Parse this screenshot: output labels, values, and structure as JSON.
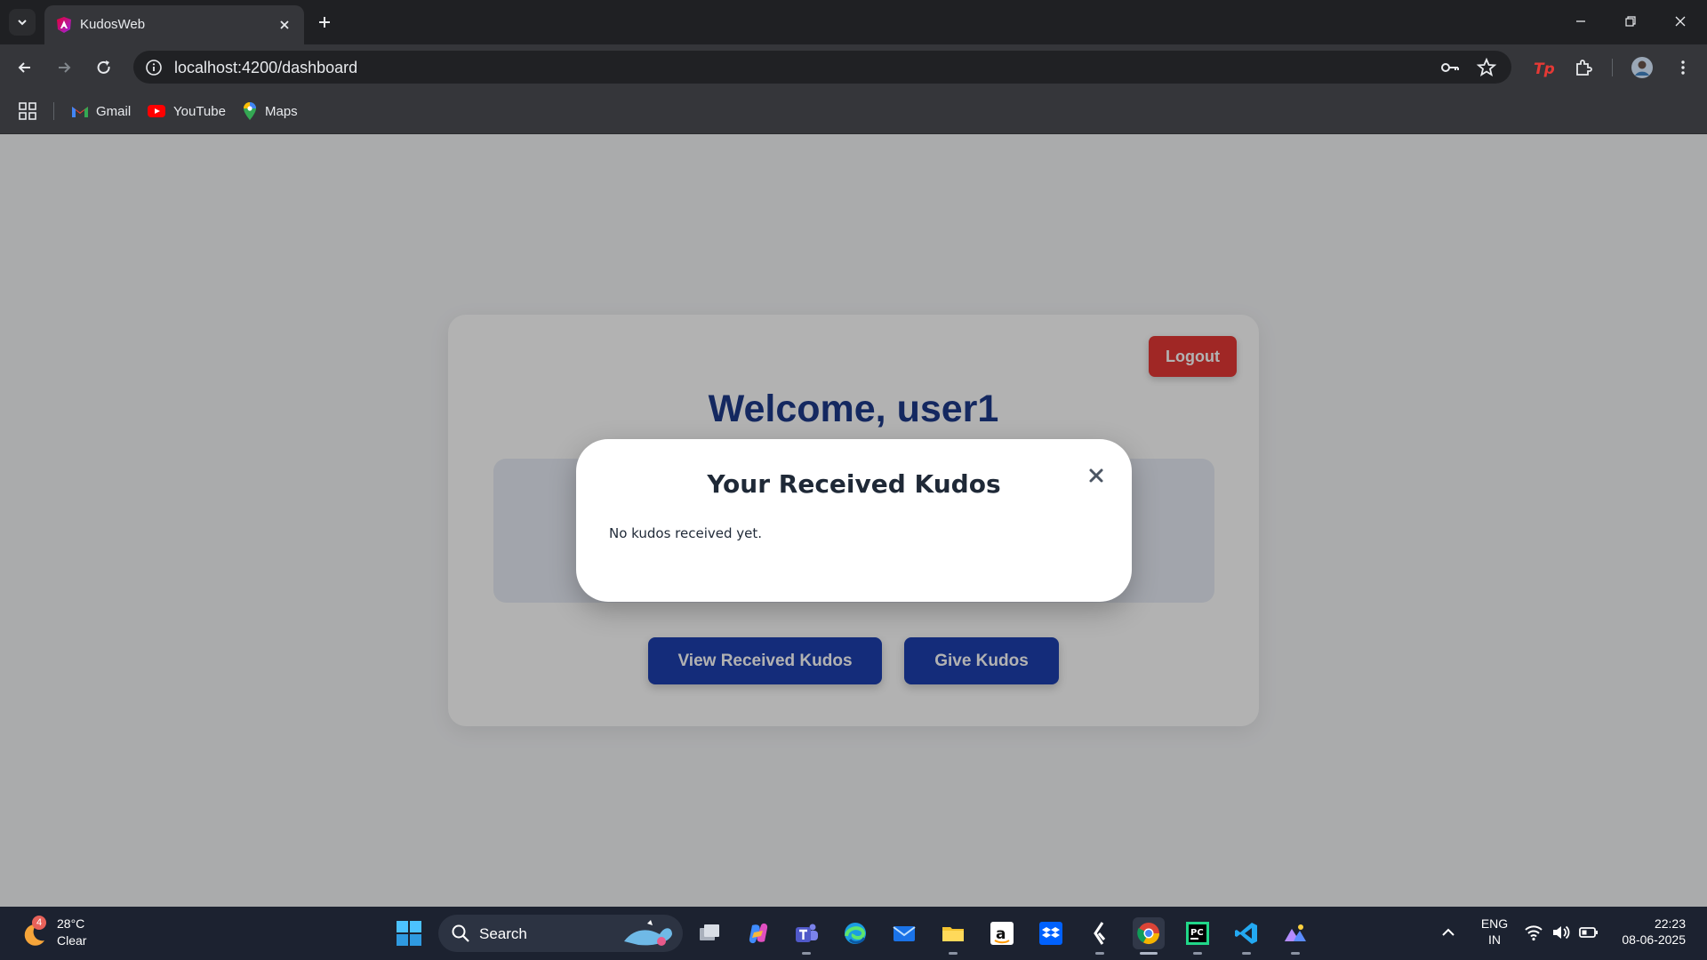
{
  "browser": {
    "tab_title": "KudosWeb",
    "url": "localhost:4200/dashboard",
    "bookmarks": [
      {
        "label": "Gmail",
        "icon": "gmail-icon"
      },
      {
        "label": "YouTube",
        "icon": "youtube-icon"
      },
      {
        "label": "Maps",
        "icon": "maps-icon"
      }
    ]
  },
  "dashboard": {
    "logout_label": "Logout",
    "welcome": "Welcome, user1",
    "view_button": "View Received Kudos",
    "give_button": "Give Kudos"
  },
  "modal": {
    "title": "Your Received Kudos",
    "empty_text": "No kudos received yet.",
    "close_icon": "close-icon"
  },
  "taskbar": {
    "weather_badge": "4",
    "temperature": "28°C",
    "weather_desc": "Clear",
    "search_placeholder": "Search",
    "language_line1": "ENG",
    "language_line2": "IN",
    "time": "22:23",
    "date": "08-06-2025"
  },
  "colors": {
    "primary": "#1e40af",
    "danger": "#e53935",
    "heading": "#1e3a8a"
  }
}
